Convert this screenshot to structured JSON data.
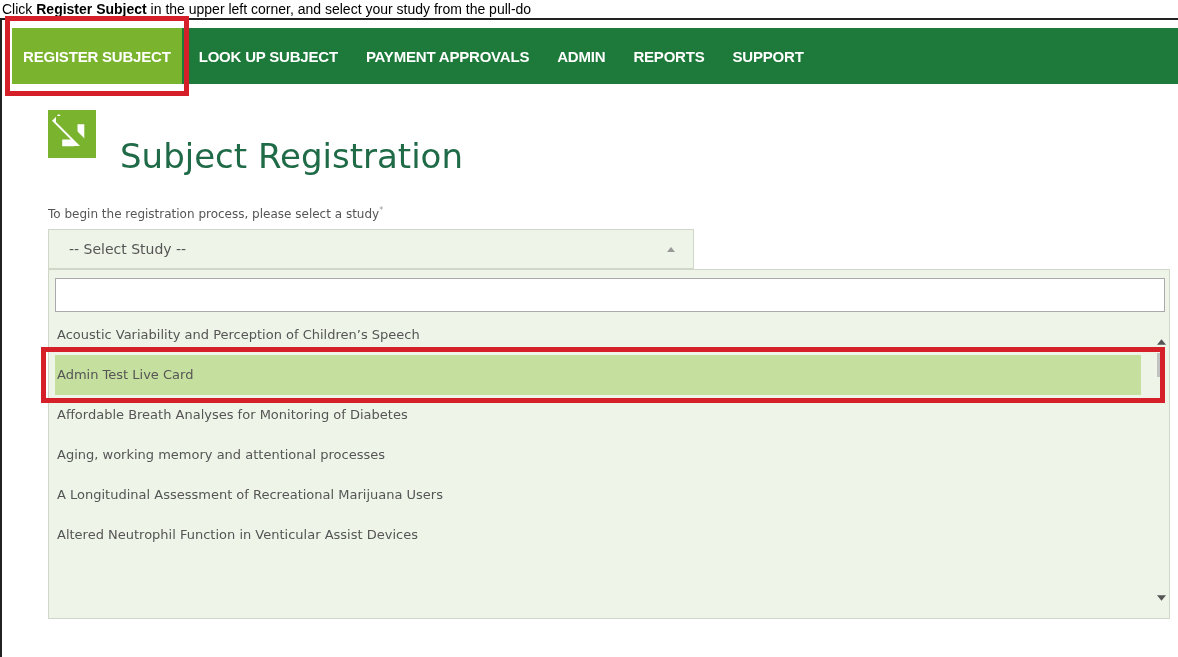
{
  "caption": "Click **Register Subject** in the upper left corner, and select your study from the pull-do",
  "nav": {
    "items": [
      {
        "label": "REGISTER SUBJECT",
        "selected": true,
        "highlighted": true
      },
      {
        "label": "LOOK UP SUBJECT",
        "selected": false,
        "highlighted": false
      },
      {
        "label": "PAYMENT APPROVALS",
        "selected": false,
        "highlighted": false
      },
      {
        "label": "ADMIN",
        "selected": false,
        "highlighted": false
      },
      {
        "label": "REPORTS",
        "selected": false,
        "highlighted": false
      },
      {
        "label": "SUPPORT",
        "selected": false,
        "highlighted": false
      }
    ]
  },
  "page": {
    "title": "Subject Registration",
    "prompt": "To begin the registration process, please select a study",
    "required_mark": "*"
  },
  "study_select": {
    "value": "-- Select Study --",
    "expanded": true
  },
  "dropdown": {
    "options": [
      {
        "label": "Acoustic Variability and Perception of Children’s Speech",
        "selected": false,
        "highlighted": false
      },
      {
        "label": "Admin Test Live Card",
        "selected": true,
        "highlighted": true
      },
      {
        "label": "Affordable Breath Analyses for Monitoring of Diabetes",
        "selected": false,
        "highlighted": false
      },
      {
        "label": "Aging, working memory and attentional processes",
        "selected": false,
        "highlighted": false
      },
      {
        "label": "A Longitudinal Assessment of Recreational Marijuana Users",
        "selected": false,
        "highlighted": false
      },
      {
        "label": "Altered Neutrophil Function in Venticular Assist Devices",
        "selected": false,
        "highlighted": false
      }
    ]
  }
}
